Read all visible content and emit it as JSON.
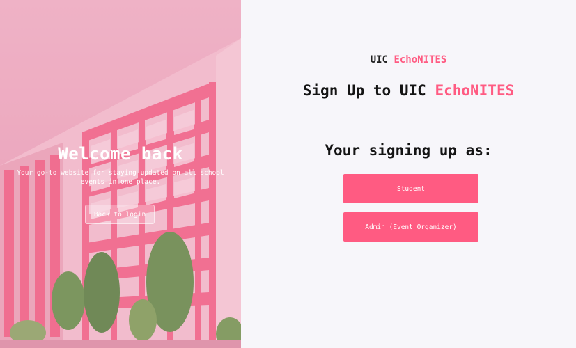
{
  "hero": {
    "title": "Welcome back",
    "subtitle": "Your go-to website for staying updated on all school events in one place.",
    "back_button_label": "Back to login"
  },
  "signup": {
    "brand_prefix": "UIC",
    "brand_highlight": "EchoNITES",
    "heading_prefix": "Sign Up to UIC",
    "heading_highlight": "EchoNITES",
    "prompt": "Your signing up as:",
    "roles": [
      {
        "label": "Student"
      },
      {
        "label": "Admin (Event Organizer)"
      }
    ]
  },
  "colors": {
    "accent": "#ff5b82",
    "panel_background": "#f7f6fa",
    "hero_tint": "#eba9be"
  }
}
